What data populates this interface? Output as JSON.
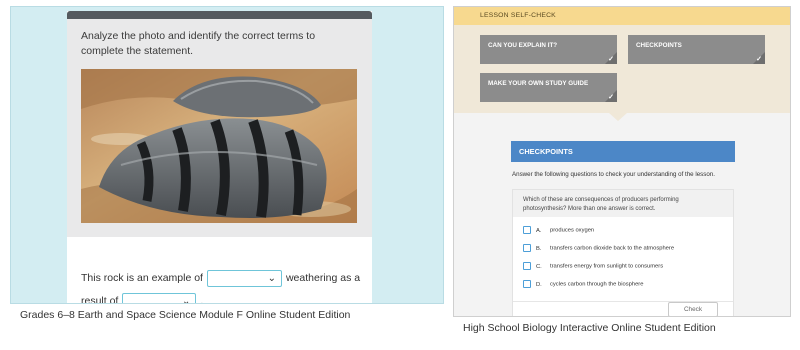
{
  "left": {
    "prompt": "Analyze the photo and identify the correct terms to complete the statement.",
    "sentence_part1": "This rock is an example of",
    "sentence_part2": "weathering as a",
    "sentence_part3": "result of",
    "sentence_end": ".",
    "dropdown1_value": "",
    "dropdown2_value": "",
    "caption": "Grades 6–8 Earth and Space Science Module F Online Student Edition"
  },
  "right": {
    "section_label": "LESSON SELF-CHECK",
    "tiles": [
      {
        "label": "CAN YOU EXPLAIN IT?"
      },
      {
        "label": "CHECKPOINTS"
      },
      {
        "label": "MAKE YOUR OWN STUDY GUIDE"
      }
    ],
    "checkpoints_title": "CHECKPOINTS",
    "intro": "Answer the following questions to check your understanding of the lesson.",
    "question": "Which of these are consequences of producers performing photosynthesis? More than one answer is correct.",
    "options": [
      {
        "letter": "A.",
        "text": "produces oxygen"
      },
      {
        "letter": "B.",
        "text": "transfers carbon dioxide back to the atmosphere"
      },
      {
        "letter": "C.",
        "text": "transfers energy from sunlight to consumers"
      },
      {
        "letter": "D.",
        "text": "cycles carbon through the biosphere"
      }
    ],
    "check_button": "Check",
    "caption": "High School Biology Interactive Online Student Edition"
  },
  "colors": {
    "left_bg": "#d3edf2",
    "accent_blue": "#4c87c7",
    "tile_gray": "#8c8c8c",
    "self_check_yellow": "#f7d98f"
  }
}
